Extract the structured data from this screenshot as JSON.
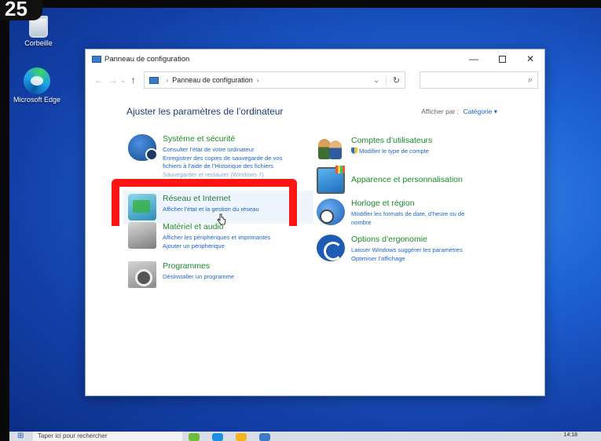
{
  "step_badge": "25",
  "desktop": {
    "icons": [
      {
        "label": "Corbeille",
        "icon": "recycle-bin-icon"
      },
      {
        "label": "Microsoft Edge",
        "icon": "edge-icon"
      }
    ]
  },
  "window": {
    "title": "Panneau de configuration",
    "controls": {
      "minimize": "—",
      "close": "✕"
    },
    "address": {
      "back": "←",
      "forward": "→",
      "up": "↑",
      "path": "Panneau de configuration",
      "separator": "›",
      "dropdown": "⌄",
      "refresh": "↻"
    },
    "search": {
      "placeholder": "",
      "icon": "⌕"
    },
    "heading": "Ajuster les paramètres de l’ordinateur",
    "view_by": {
      "label": "Afficher par :",
      "value": "Catégorie ▾"
    }
  },
  "categories": {
    "security": {
      "title": "Système et sécurité",
      "links": [
        "Consulter l’état de votre ordinateur",
        "Enregistrer des copies de sauvegarde de vos",
        "fichiers à l’aide de l’Historique des fichiers",
        "Sauvegarder et restaurer (Windows 7)"
      ]
    },
    "network": {
      "title": "Réseau et Internet",
      "links": [
        "Afficher l’état et la gestion du réseau"
      ]
    },
    "hardware": {
      "title": "Matériel et audio",
      "links": [
        "Afficher les périphériques et imprimantes",
        "Ajouter un périphérique"
      ]
    },
    "programs": {
      "title": "Programmes",
      "links": [
        "Désinstaller un programme"
      ]
    },
    "users": {
      "title": "Comptes d’utilisateurs",
      "links": [
        "Modifier le type de compte"
      ]
    },
    "appearance": {
      "title": "Apparence et personnalisation",
      "links": []
    },
    "clock": {
      "title": "Horloge et région",
      "links": [
        "Modifier les formats de date, d’heure ou de",
        "nombre"
      ]
    },
    "ease": {
      "title": "Options d’ergonomie",
      "links": [
        "Laisser Windows suggérer les paramètres",
        "Optimiser l’affichage"
      ]
    }
  },
  "taskbar": {
    "start": "⊞",
    "search_text": "Taper ici pour rechercher",
    "clock": "14:18"
  },
  "colors": {
    "highlight": "#ff1414",
    "link": "#1a66cc",
    "category_title": "#1a8a2c",
    "heading": "#1e3b78"
  }
}
